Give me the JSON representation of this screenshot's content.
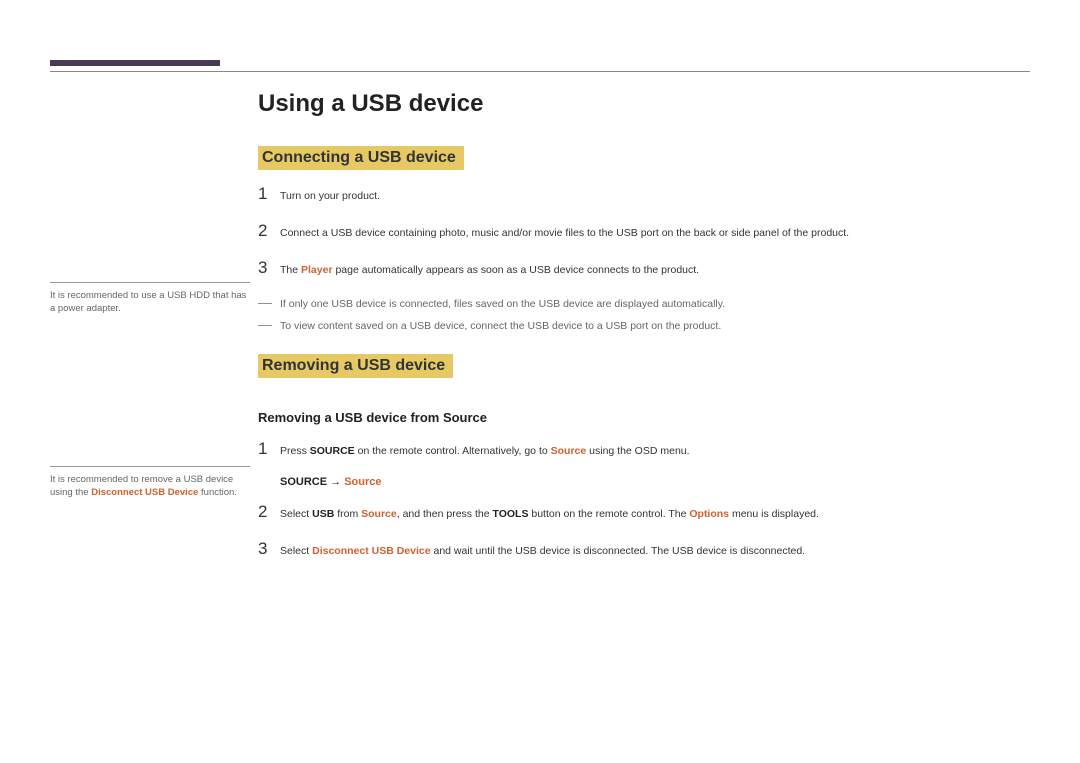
{
  "main_title": "Using a USB device",
  "section1": {
    "heading": "Connecting a USB device",
    "step1_num": "1",
    "step1_text": "Turn on your product.",
    "step2_num": "2",
    "step2_text": "Connect a USB device containing photo, music and/or movie files to the USB port on the back or side panel of the product.",
    "step3_num": "3",
    "step3_pre": "The ",
    "step3_player": "Player",
    "step3_post": " page automatically appears as soon as a USB device connects to the product.",
    "note1": "If only one USB device is connected, files saved on the USB device are displayed automatically.",
    "note2": "To view content saved on a USB device, connect the USB device to a USB port on the product."
  },
  "section2": {
    "heading": "Removing a USB device",
    "subheading": "Removing a USB device from Source",
    "step1_num": "1",
    "step1_pre": "Press ",
    "step1_source": "SOURCE",
    "step1_mid": " on the remote control. Alternatively, go to ",
    "step1_source2": "Source",
    "step1_post": " using the OSD menu.",
    "path_source": "SOURCE",
    "path_arrow": " → ",
    "path_source2": "Source",
    "step2_num": "2",
    "step2_pre": "Select ",
    "step2_usb": "USB",
    "step2_mid1": " from ",
    "step2_source": "Source",
    "step2_mid2": ", and then press the ",
    "step2_tools": "TOOLS",
    "step2_mid3": " button on the remote control. The ",
    "step2_options": "Options",
    "step2_post": " menu is displayed.",
    "step3_num": "3",
    "step3_pre": "Select ",
    "step3_disconnect": "Disconnect USB Device",
    "step3_post": " and wait until the USB device is disconnected. The USB device is disconnected."
  },
  "sidebar": {
    "note1": "It is recommended to use a USB HDD that has a power adapter.",
    "note2_pre": "It is recommended to remove a USB device using the ",
    "note2_bold": "Disconnect USB Device",
    "note2_post": " function."
  }
}
